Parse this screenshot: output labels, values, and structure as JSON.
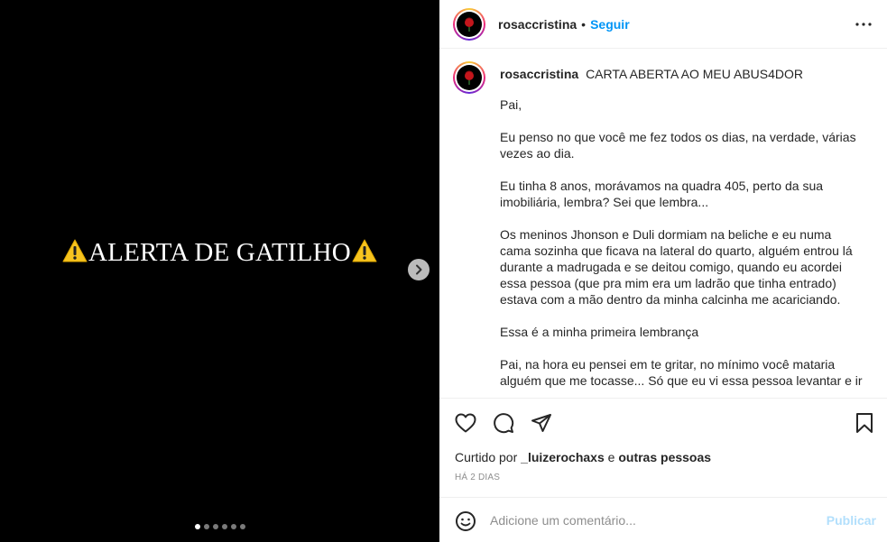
{
  "media": {
    "title": "ALERTA DE GATILHO",
    "slide_count": 6,
    "active_slide": 1
  },
  "header": {
    "username": "rosaccristina",
    "separator": "•",
    "follow_label": "Seguir"
  },
  "caption": {
    "username": "rosaccristina",
    "title": "CARTA ABERTA AO MEU ABUS4DOR",
    "paragraphs": [
      "Pai,",
      "Eu penso no que você me fez todos os dias, na verdade, várias vezes ao dia.",
      "Eu tinha 8 anos, morávamos na quadra 405, perto da sua imobiliária, lembra? Sei que lembra...",
      "Os meninos Jhonson e Duli dormiam na beliche e eu numa cama sozinha que ficava na lateral do quarto, alguém entrou lá durante a madrugada e se deitou comigo, quando eu acordei essa pessoa (que pra mim era um ladrão que tinha entrado) estava com a mão dentro da minha calcinha me acariciando.",
      "Essa é a minha primeira lembrança",
      "Pai, na hora eu pensei em te gritar, no mínimo você mataria alguém que me tocasse... Só que eu vi essa pessoa levantar e ir"
    ]
  },
  "likes": {
    "prefix": "Curtido por",
    "user": "_luizerochaxs",
    "connector": "e",
    "others": "outras pessoas"
  },
  "timestamp": "HÁ 2 DIAS",
  "comment": {
    "placeholder": "Adicione um comentário...",
    "post_label": "Publicar"
  },
  "colors": {
    "accent": "#0095f6",
    "post_disabled": "#b2dffc",
    "muted": "#8e8e8e",
    "media_bg": "#000000"
  }
}
